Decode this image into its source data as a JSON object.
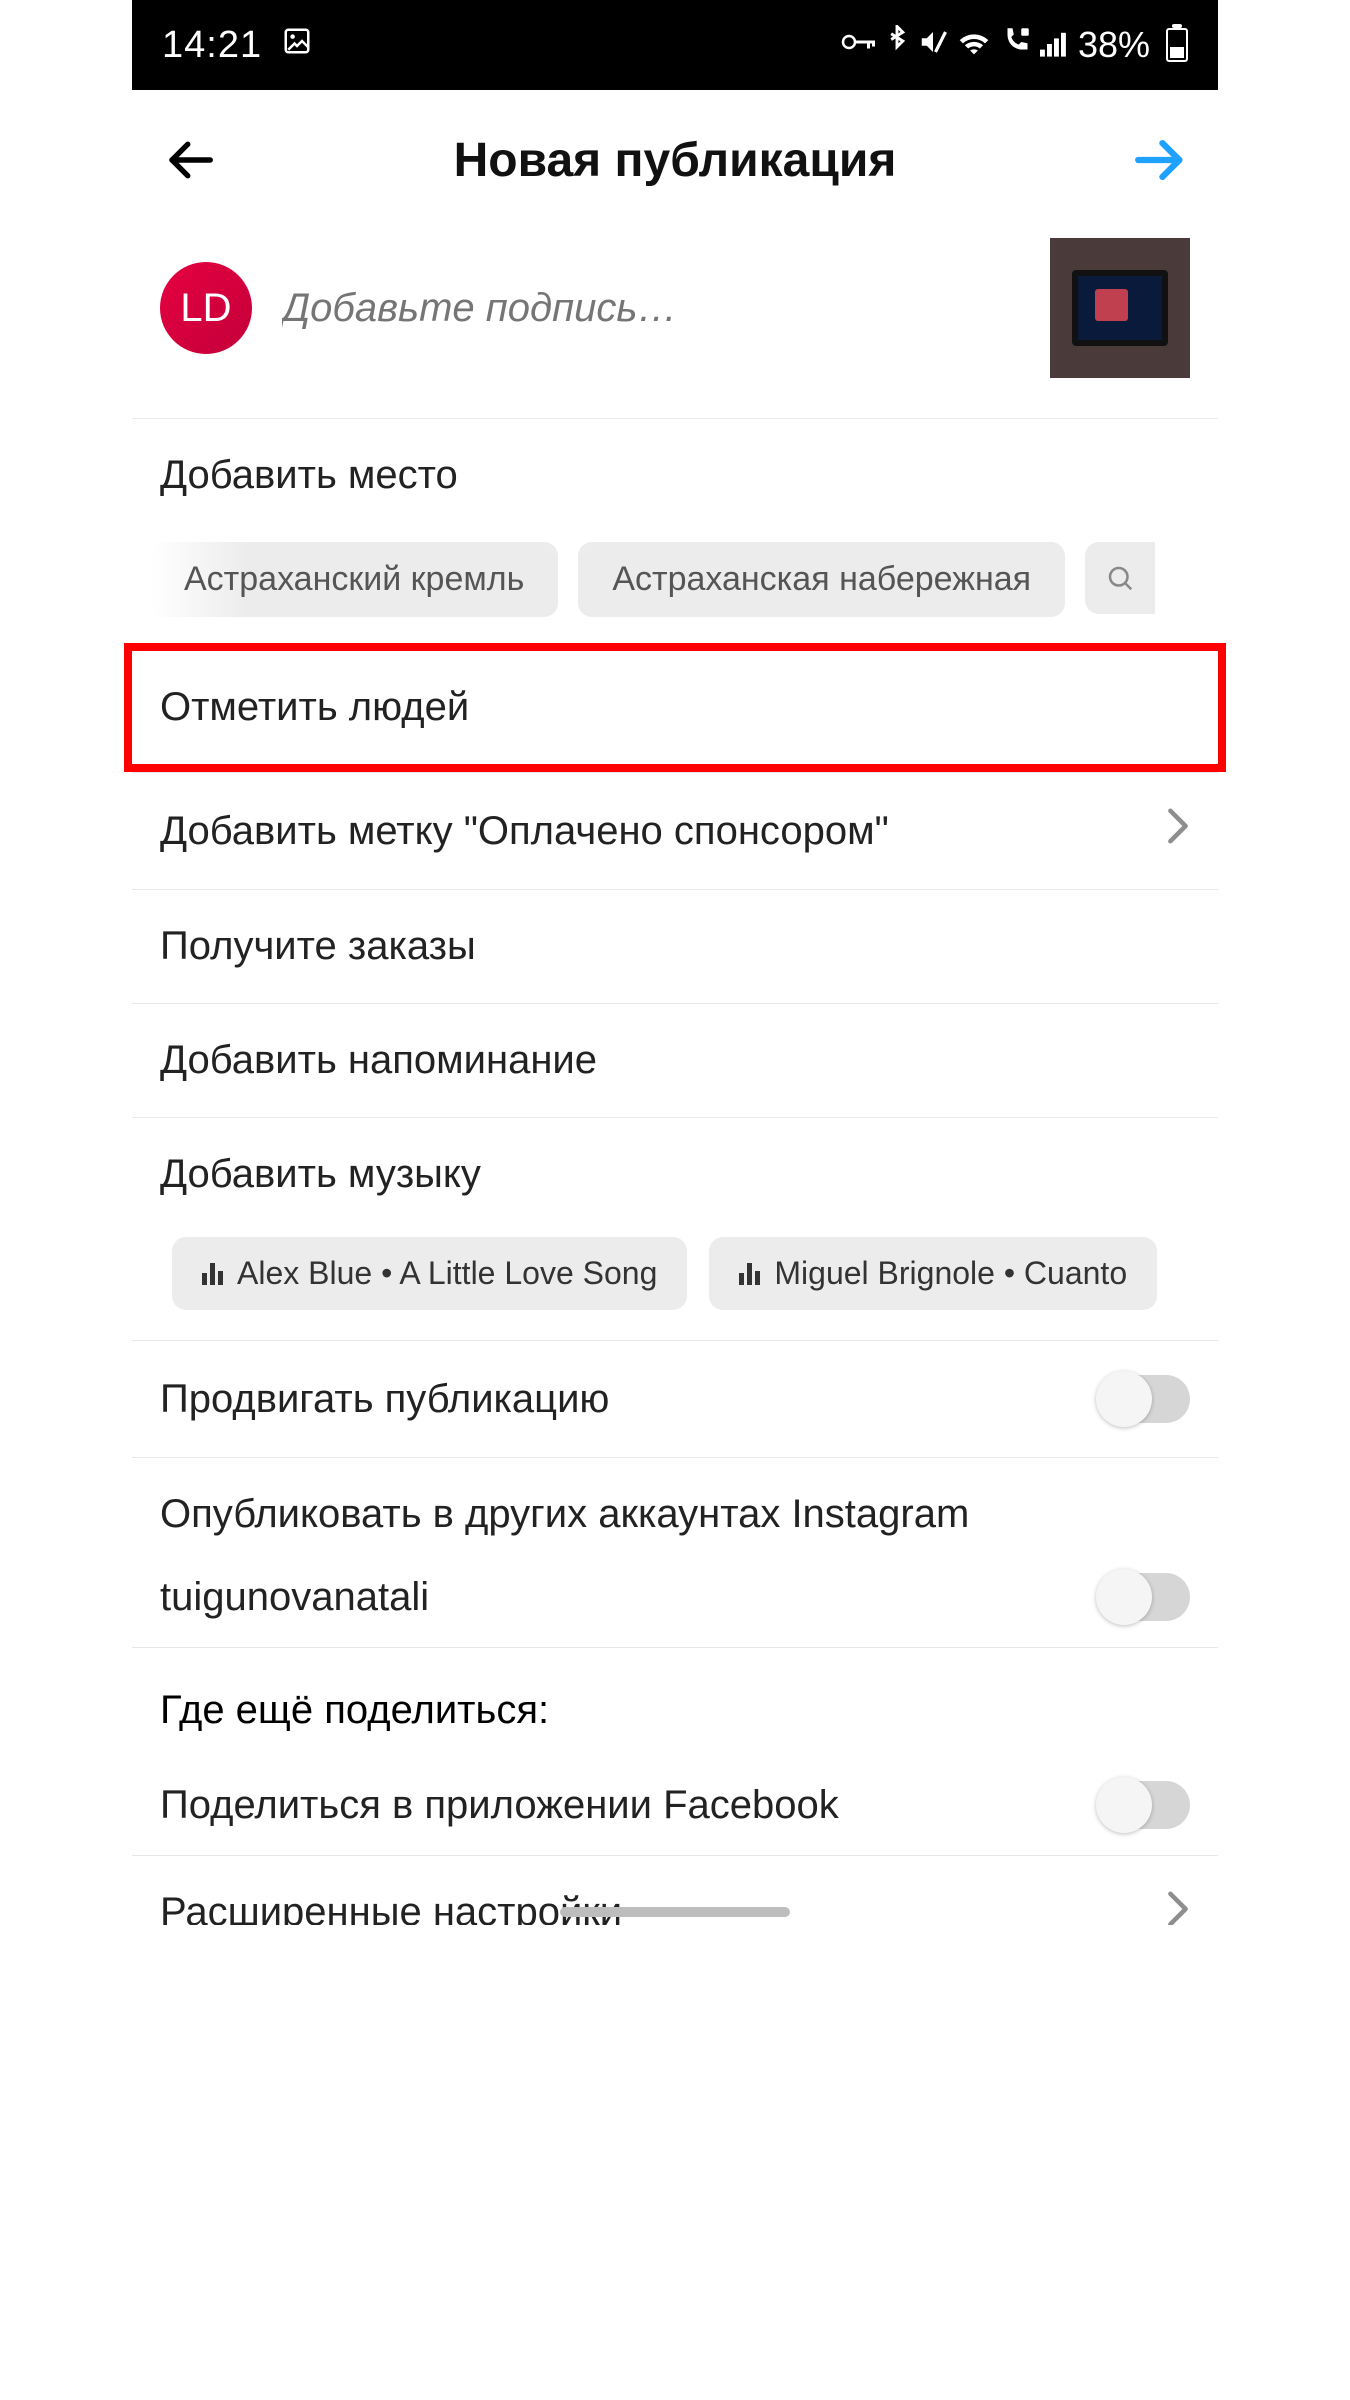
{
  "status": {
    "time": "14:21",
    "battery_text": "38%"
  },
  "header": {
    "title": "Новая публикация"
  },
  "caption": {
    "avatar_initials": "LD",
    "placeholder": "Добавьте подпись…"
  },
  "rows": {
    "add_location": "Добавить место",
    "tag_people": "Отметить людей",
    "paid_partnership": "Добавить метку \"Оплачено спонсором\"",
    "get_orders": "Получите заказы",
    "add_reminder": "Добавить напоминание",
    "add_music": "Добавить музыку",
    "boost_post": "Продвигать публикацию",
    "post_other_accounts": "Опубликовать в других аккаунтах Instagram",
    "account_name": "tuigunovanatali",
    "share_elsewhere": "Где ещё поделиться:",
    "share_facebook": "Поделиться в приложении Facebook",
    "advanced_settings": "Расширенные настройки"
  },
  "location_chips": [
    "Астраханский кремль",
    "Астраханская набережная"
  ],
  "music_chips": [
    "Alex Blue • A Little Love Song",
    "Miguel Brignole • Cuanto"
  ]
}
